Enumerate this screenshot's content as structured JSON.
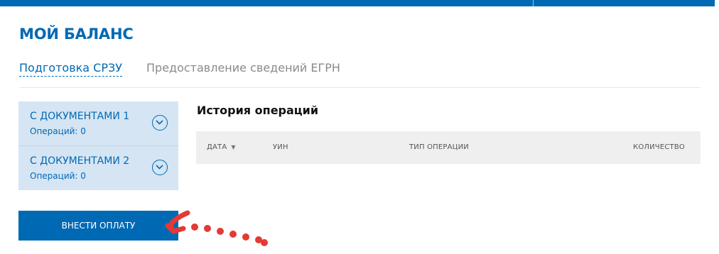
{
  "page": {
    "title": "МОЙ БАЛАНС"
  },
  "tabs": [
    {
      "label": "Подготовка СРЗУ",
      "active": true
    },
    {
      "label": "Предоставление сведений ЕГРН",
      "active": false
    }
  ],
  "balances": [
    {
      "name": "С ДОКУМЕНТАМИ 1",
      "operations": "Операций: 0"
    },
    {
      "name": "С ДОКУМЕНТАМИ 2",
      "operations": "Операций: 0"
    }
  ],
  "history": {
    "title": "История операций",
    "columns": [
      "ДАТА",
      "УИН",
      "ТИП ОПЕРАЦИИ",
      "КОЛИЧЕСТВО"
    ],
    "sort_icon": "sort-down-icon",
    "rows": []
  },
  "pay_button": {
    "label": "ВНЕСТИ ОПЛАТУ"
  },
  "colors": {
    "brand_blue": "#0069b4",
    "panel_bg": "#d5e5f3",
    "table_header_bg": "#efefef",
    "annotation_red": "#e53935"
  }
}
